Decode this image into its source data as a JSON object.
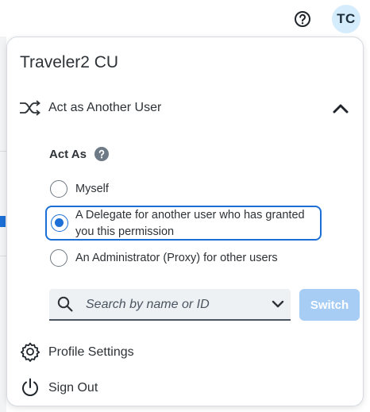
{
  "header": {
    "help_icon": "question-circle-icon",
    "avatar_initials": "TC"
  },
  "panel": {
    "title": "Traveler2 CU",
    "section": {
      "icon": "shuffle-icon",
      "label": "Act as Another User",
      "expanded": true
    },
    "act_as": {
      "label": "Act As",
      "info_icon": "help-circle-icon",
      "options": [
        {
          "label": "Myself",
          "selected": false
        },
        {
          "label": "A Delegate for another user who has granted you this permission",
          "selected": true
        },
        {
          "label": "An Administrator (Proxy) for other users",
          "selected": false
        }
      ]
    },
    "search": {
      "placeholder": "Search by name or ID",
      "value": ""
    },
    "switch_label": "Switch",
    "menu": [
      {
        "icon": "gear-icon",
        "label": "Profile Settings"
      },
      {
        "icon": "power-icon",
        "label": "Sign Out"
      }
    ]
  },
  "colors": {
    "accent": "#1c6fd6",
    "switch_disabled": "#a7cdf5",
    "avatar_bg": "#d4ecfb"
  }
}
